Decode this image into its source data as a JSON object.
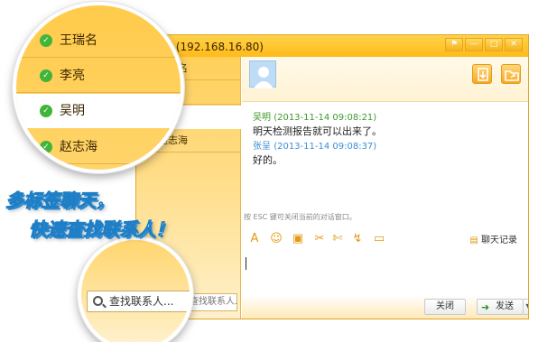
{
  "window": {
    "title": "吴明 (192.168.16.80)",
    "controls": [
      "⚑",
      "—",
      "□",
      "✕"
    ]
  },
  "contacts": [
    {
      "name": "王瑞名",
      "selected": false
    },
    {
      "name": "李亮",
      "selected": false
    },
    {
      "name": "吴明",
      "selected": true
    },
    {
      "name": "赵志海",
      "selected": false
    }
  ],
  "contact_search_placeholder": "查找联系人...",
  "chat": {
    "messages": [
      {
        "sender": "吴明",
        "time": "(2013-11-14 09:08:21)",
        "text": "明天检测报告就可以出来了。",
        "color": "#3f9a2a"
      },
      {
        "sender": "张呈",
        "time": "(2013-11-14 09:08:37)",
        "text": "好的。",
        "color": "#3a8ed6"
      }
    ],
    "hint": "按 ESC 键可关闭当前的对话窗口。",
    "toolbar_icons": [
      "font-icon",
      "emoji-icon",
      "image-icon",
      "cut-icon",
      "screenshot-icon",
      "shake-icon",
      "folder-icon"
    ],
    "history_label": "聊天记录",
    "close_label": "关闭",
    "send_label": "发送"
  },
  "slogan": {
    "line1": "多标签聊天，",
    "line2": "快速查找联系人！"
  },
  "colors": {
    "accent": "#ffbb1a",
    "online": "#3fb53a",
    "slogan_outline": "#1f7fc6"
  }
}
